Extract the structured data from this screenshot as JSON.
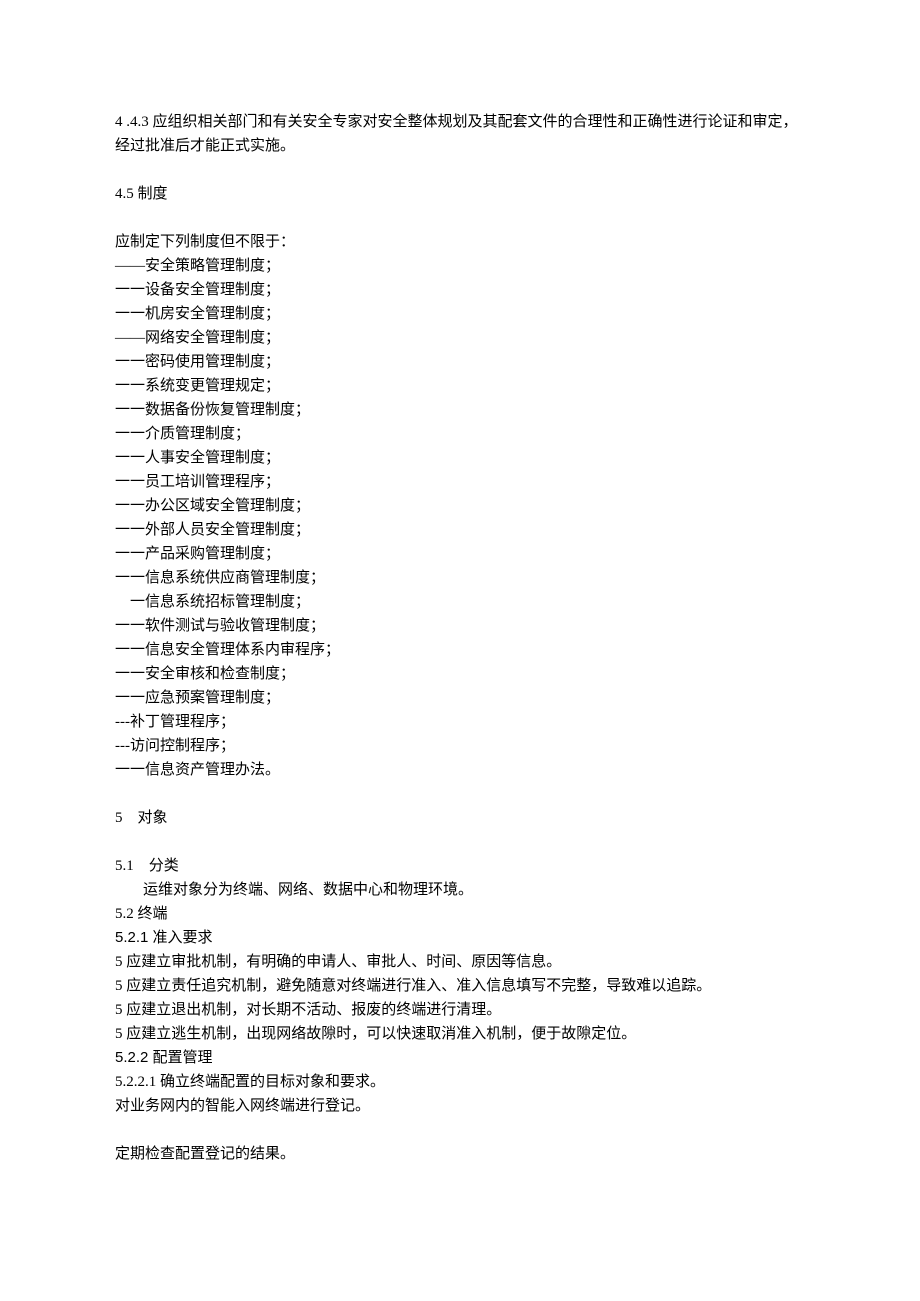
{
  "s443": "4 .4.3 应组织相关部门和有关安全专家对安全整体规划及其配套文件的合理性和正确性进行论证和审定，经过批准后才能正式实施。",
  "s45_title": "4.5 制度",
  "s45_intro": "应制定下列制度但不限于：",
  "s45_items": [
    "——安全策略管理制度；",
    "一一设备安全管理制度；",
    "一一机房安全管理制度；",
    "——网络安全管理制度；",
    "一一密码使用管理制度；",
    "一一系统变更管理规定；",
    "一一数据备份恢复管理制度；",
    "一一介质管理制度；",
    "一一人事安全管理制度；",
    "一一员工培训管理程序；",
    "一一办公区域安全管理制度；",
    "一一外部人员安全管理制度；",
    "一一产品采购管理制度；",
    "一一信息系统供应商管理制度；",
    "　一信息系统招标管理制度；",
    "一一软件测试与验收管理制度；",
    "一一信息安全管理体系内审程序；",
    "一一安全审核和检查制度；",
    "一一应急预案管理制度；",
    " ---补丁管理程序；",
    " ---访问控制程序；",
    "一一信息资产管理办法。"
  ],
  "s5_title": "5　对象",
  "s51_title": "5.1　分类",
  "s51_body": "运维对象分为终端、网络、数据中心和物理环境。",
  "s52_title": "5.2 终端",
  "s521_title": "5.2.1 准入要求",
  "s521_items": [
    "5 应建立审批机制，有明确的申请人、审批人、时间、原因等信息。",
    "5 应建立责任追究机制，避免随意对终端进行准入、准入信息填写不完整，导致难以追踪。",
    "5 应建立退出机制，对长期不活动、报废的终端进行清理。",
    "5 应建立逃生机制，出现网络故隙时，可以快速取消准入机制，便于故隙定位。"
  ],
  "s522_title": "5.2.2 配置管理",
  "s5221": "5.2.2.1 确立终端配置的目标对象和要求。",
  "s5221_body1": "对业务网内的智能入网终端进行登记。",
  "s5221_body2": "定期检查配置登记的结果。"
}
